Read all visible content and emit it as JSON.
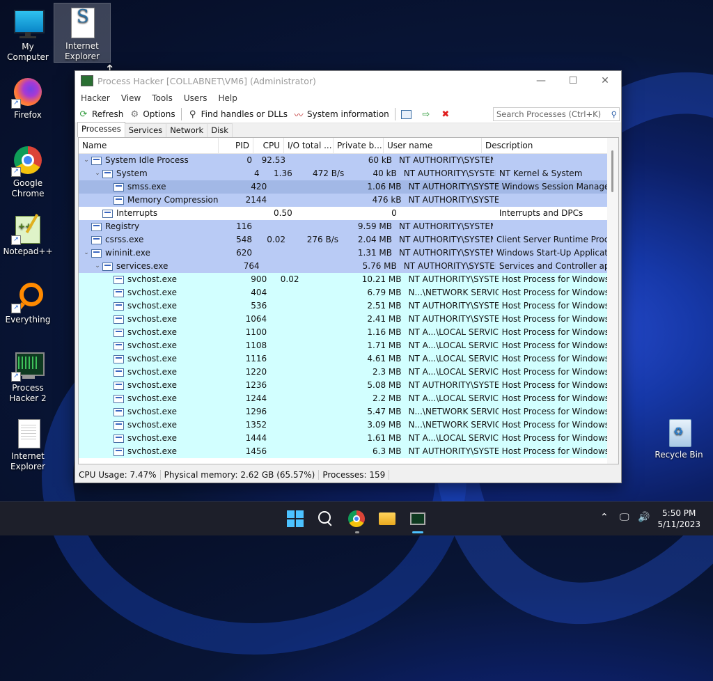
{
  "desktop": {
    "icons": [
      {
        "label": "My Computer",
        "name": "my-computer"
      },
      {
        "label": "Internet Explorer",
        "name": "internet-explorer-top"
      },
      {
        "label": "Firefox",
        "name": "firefox"
      },
      {
        "label": "Google Chrome",
        "name": "google-chrome"
      },
      {
        "label": "Notepad++",
        "name": "notepad-plus-plus"
      },
      {
        "label": "Everything",
        "name": "everything"
      },
      {
        "label": "Process Hacker 2",
        "name": "process-hacker-2"
      },
      {
        "label": "Internet Explorer",
        "name": "internet-explorer"
      },
      {
        "label": "Recycle Bin",
        "name": "recycle-bin"
      }
    ]
  },
  "window": {
    "title": "Process Hacker [COLLABNET\\VM6] (Administrator)",
    "menu": [
      "Hacker",
      "View",
      "Tools",
      "Users",
      "Help"
    ],
    "toolbar": {
      "refresh": "Refresh",
      "options": "Options",
      "find_handles": "Find handles or DLLs",
      "system_info": "System information",
      "search_placeholder": "Search Processes (Ctrl+K)"
    },
    "tabs": [
      "Processes",
      "Services",
      "Network",
      "Disk"
    ],
    "columns": [
      "Name",
      "PID",
      "CPU",
      "I/O total ...",
      "Private b...",
      "User name",
      "Description"
    ],
    "rows": [
      {
        "indent": 0,
        "exp": "v",
        "name": "System Idle Process",
        "pid": "0",
        "cpu": "92.53",
        "io": "",
        "priv": "60 kB",
        "user": "NT AUTHORITY\\SYSTEM",
        "desc": "",
        "bg": "blue"
      },
      {
        "indent": 1,
        "exp": "v",
        "name": "System",
        "pid": "4",
        "cpu": "1.36",
        "io": "472 B/s",
        "priv": "40 kB",
        "user": "NT AUTHORITY\\SYSTEM",
        "desc": "NT Kernel & System",
        "bg": "blue"
      },
      {
        "indent": 2,
        "exp": "",
        "name": "smss.exe",
        "pid": "420",
        "cpu": "",
        "io": "",
        "priv": "1.06 MB",
        "user": "NT AUTHORITY\\SYSTEM",
        "desc": "Windows Session Manager",
        "bg": "sel"
      },
      {
        "indent": 2,
        "exp": "",
        "name": "Memory Compression",
        "pid": "2144",
        "cpu": "",
        "io": "",
        "priv": "476 kB",
        "user": "NT AUTHORITY\\SYSTEM",
        "desc": "",
        "bg": "blue"
      },
      {
        "indent": 1,
        "exp": "",
        "name": "Interrupts",
        "pid": "",
        "cpu": "0.50",
        "io": "",
        "priv": "0",
        "user": "",
        "desc": "Interrupts and DPCs",
        "bg": "white"
      },
      {
        "indent": 0,
        "exp": "",
        "name": "Registry",
        "pid": "116",
        "cpu": "",
        "io": "",
        "priv": "9.59 MB",
        "user": "NT AUTHORITY\\SYSTEM",
        "desc": "",
        "bg": "blue"
      },
      {
        "indent": 0,
        "exp": "",
        "name": "csrss.exe",
        "pid": "548",
        "cpu": "0.02",
        "io": "276 B/s",
        "priv": "2.04 MB",
        "user": "NT AUTHORITY\\SYSTEM",
        "desc": "Client Server Runtime Process",
        "bg": "blue"
      },
      {
        "indent": 0,
        "exp": "v",
        "name": "wininit.exe",
        "pid": "620",
        "cpu": "",
        "io": "",
        "priv": "1.31 MB",
        "user": "NT AUTHORITY\\SYSTEM",
        "desc": "Windows Start-Up Application",
        "bg": "blue"
      },
      {
        "indent": 1,
        "exp": "v",
        "name": "services.exe",
        "pid": "764",
        "cpu": "",
        "io": "",
        "priv": "5.76 MB",
        "user": "NT AUTHORITY\\SYSTEM",
        "desc": "Services and Controller app",
        "bg": "blue"
      },
      {
        "indent": 2,
        "exp": "",
        "name": "svchost.exe",
        "pid": "900",
        "cpu": "0.02",
        "io": "",
        "priv": "10.21 MB",
        "user": "NT AUTHORITY\\SYSTEM",
        "desc": "Host Process for Windows Ser...",
        "bg": "cyan"
      },
      {
        "indent": 2,
        "exp": "",
        "name": "svchost.exe",
        "pid": "404",
        "cpu": "",
        "io": "",
        "priv": "6.79 MB",
        "user": "N...\\NETWORK SERVICE",
        "desc": "Host Process for Windows Ser...",
        "bg": "cyan"
      },
      {
        "indent": 2,
        "exp": "",
        "name": "svchost.exe",
        "pid": "536",
        "cpu": "",
        "io": "",
        "priv": "2.51 MB",
        "user": "NT AUTHORITY\\SYSTEM",
        "desc": "Host Process for Windows Ser...",
        "bg": "cyan"
      },
      {
        "indent": 2,
        "exp": "",
        "name": "svchost.exe",
        "pid": "1064",
        "cpu": "",
        "io": "",
        "priv": "2.41 MB",
        "user": "NT AUTHORITY\\SYSTEM",
        "desc": "Host Process for Windows Ser...",
        "bg": "cyan"
      },
      {
        "indent": 2,
        "exp": "",
        "name": "svchost.exe",
        "pid": "1100",
        "cpu": "",
        "io": "",
        "priv": "1.16 MB",
        "user": "NT A...\\LOCAL SERVICE",
        "desc": "Host Process for Windows Ser...",
        "bg": "cyan"
      },
      {
        "indent": 2,
        "exp": "",
        "name": "svchost.exe",
        "pid": "1108",
        "cpu": "",
        "io": "",
        "priv": "1.71 MB",
        "user": "NT A...\\LOCAL SERVICE",
        "desc": "Host Process for Windows Ser...",
        "bg": "cyan"
      },
      {
        "indent": 2,
        "exp": "",
        "name": "svchost.exe",
        "pid": "1116",
        "cpu": "",
        "io": "",
        "priv": "4.61 MB",
        "user": "NT A...\\LOCAL SERVICE",
        "desc": "Host Process for Windows Ser...",
        "bg": "cyan"
      },
      {
        "indent": 2,
        "exp": "",
        "name": "svchost.exe",
        "pid": "1220",
        "cpu": "",
        "io": "",
        "priv": "2.3 MB",
        "user": "NT A...\\LOCAL SERVICE",
        "desc": "Host Process for Windows Ser...",
        "bg": "cyan"
      },
      {
        "indent": 2,
        "exp": "",
        "name": "svchost.exe",
        "pid": "1236",
        "cpu": "",
        "io": "",
        "priv": "5.08 MB",
        "user": "NT AUTHORITY\\SYSTEM",
        "desc": "Host Process for Windows Ser...",
        "bg": "cyan"
      },
      {
        "indent": 2,
        "exp": "",
        "name": "svchost.exe",
        "pid": "1244",
        "cpu": "",
        "io": "",
        "priv": "2.2 MB",
        "user": "NT A...\\LOCAL SERVICE",
        "desc": "Host Process for Windows Ser...",
        "bg": "cyan"
      },
      {
        "indent": 2,
        "exp": "",
        "name": "svchost.exe",
        "pid": "1296",
        "cpu": "",
        "io": "",
        "priv": "5.47 MB",
        "user": "N...\\NETWORK SERVICE",
        "desc": "Host Process for Windows Ser...",
        "bg": "cyan"
      },
      {
        "indent": 2,
        "exp": "",
        "name": "svchost.exe",
        "pid": "1352",
        "cpu": "",
        "io": "",
        "priv": "3.09 MB",
        "user": "N...\\NETWORK SERVICE",
        "desc": "Host Process for Windows Ser...",
        "bg": "cyan"
      },
      {
        "indent": 2,
        "exp": "",
        "name": "svchost.exe",
        "pid": "1444",
        "cpu": "",
        "io": "",
        "priv": "1.61 MB",
        "user": "NT A...\\LOCAL SERVICE",
        "desc": "Host Process for Windows Ser...",
        "bg": "cyan"
      },
      {
        "indent": 2,
        "exp": "",
        "name": "svchost.exe",
        "pid": "1456",
        "cpu": "",
        "io": "",
        "priv": "6.3 MB",
        "user": "NT AUTHORITY\\SYSTEM",
        "desc": "Host Process for Windows Ser...",
        "bg": "cyan"
      }
    ],
    "status": {
      "cpu": "CPU Usage: 7.47%",
      "memory": "Physical memory: 2.62 GB (65.57%)",
      "processes": "Processes: 159"
    }
  },
  "taskbar": {
    "time": "5:50 PM",
    "date": "5/11/2023"
  }
}
